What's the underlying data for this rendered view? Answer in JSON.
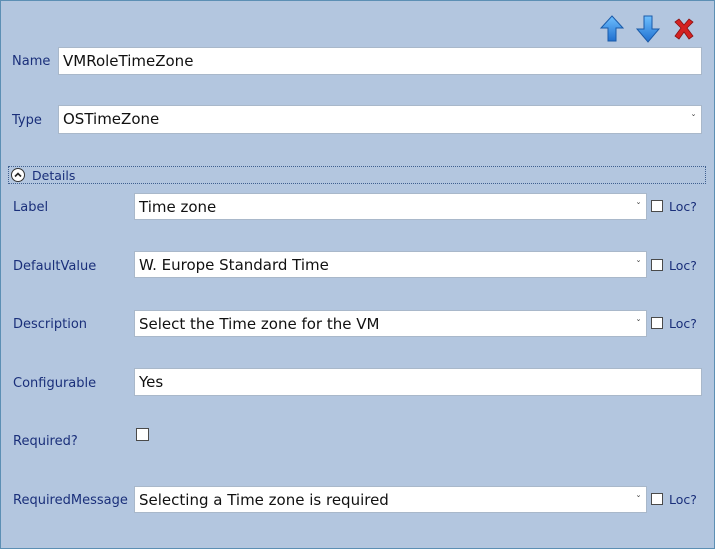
{
  "toolbar": {
    "move_up_icon": "arrow-up-icon",
    "move_down_icon": "arrow-down-icon",
    "delete_icon": "close-icon",
    "up_color": "#2f86d8",
    "down_color": "#2f86d8",
    "delete_color": "#d02020"
  },
  "name": {
    "label": "Name",
    "value": "VMRoleTimeZone"
  },
  "type": {
    "label": "Type",
    "value": "OSTimeZone"
  },
  "details": {
    "label": "Details",
    "expanded": true
  },
  "fields": {
    "label": {
      "label": "Label",
      "value": "Time zone",
      "loc": "Loc?",
      "loc_checked": false
    },
    "default_value": {
      "label": "DefaultValue",
      "value": "W. Europe Standard Time",
      "loc": "Loc?",
      "loc_checked": false
    },
    "description": {
      "label": "Description",
      "value": "Select the Time zone for the VM",
      "loc": "Loc?",
      "loc_checked": false
    },
    "configurable": {
      "label": "Configurable",
      "value": "Yes"
    },
    "required": {
      "label": "Required?",
      "checked": false
    },
    "required_message": {
      "label": "RequiredMessage",
      "value": "Selecting a Time zone is required",
      "loc": "Loc?",
      "loc_checked": false
    }
  },
  "colors": {
    "panel_bg": "#b3c6df",
    "label_text": "#1a2f7a",
    "border": "#5c8fb4"
  }
}
